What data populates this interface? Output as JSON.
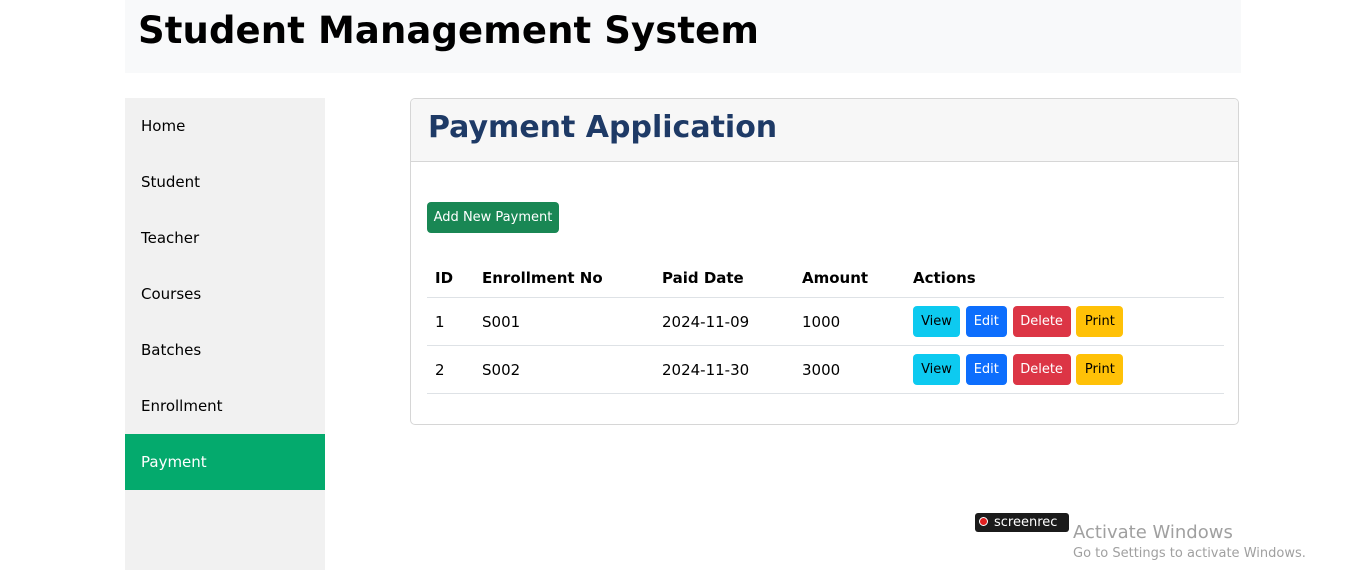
{
  "header": {
    "title": "Student Management System"
  },
  "sidebar": {
    "items": [
      {
        "label": "Home",
        "active": false
      },
      {
        "label": "Student",
        "active": false
      },
      {
        "label": "Teacher",
        "active": false
      },
      {
        "label": "Courses",
        "active": false
      },
      {
        "label": "Batches",
        "active": false
      },
      {
        "label": "Enrollment",
        "active": false
      },
      {
        "label": "Payment",
        "active": true
      }
    ]
  },
  "main": {
    "title": "Payment Application",
    "add_button_label": "Add New Payment",
    "table": {
      "columns": [
        "ID",
        "Enrollment No",
        "Paid Date",
        "Amount",
        "Actions"
      ],
      "rows": [
        {
          "id": "1",
          "enrollment_no": "S001",
          "paid_date": "2024-11-09",
          "amount": "1000"
        },
        {
          "id": "2",
          "enrollment_no": "S002",
          "paid_date": "2024-11-30",
          "amount": "3000"
        }
      ],
      "action_labels": {
        "view": "View",
        "edit": "Edit",
        "delete": "Delete",
        "print": "Print"
      }
    }
  },
  "overlay": {
    "screenrec_label": "screenrec",
    "activate_title": "Activate Windows",
    "activate_subtitle": "Go to Settings to activate Windows."
  },
  "colors": {
    "sidebar_active": "#04aa6d",
    "title_color": "#1e3a66",
    "add_button": "#198754",
    "view_button": "#0dcaf0",
    "edit_button": "#0d6efd",
    "delete_button": "#dc3545",
    "print_button": "#ffc107"
  }
}
